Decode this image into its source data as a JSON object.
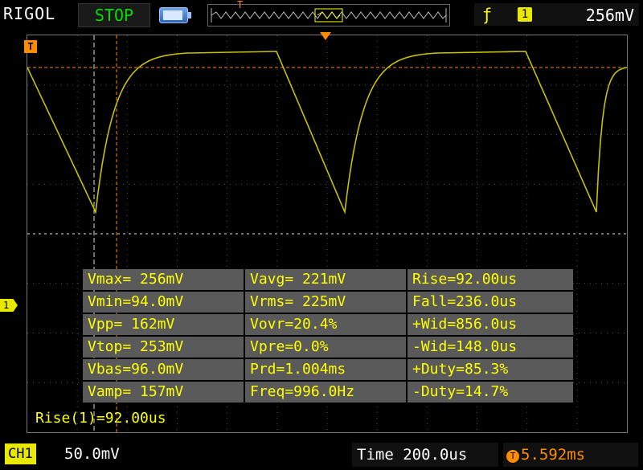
{
  "header": {
    "brand": "RIGOL",
    "run_state": "STOP",
    "trigger_source": "1",
    "trigger_edge_icon": "rising-edge-icon",
    "trigger_level": "256mV",
    "memory_marker": "T"
  },
  "screen": {
    "trigger_marker": "T",
    "channel_marker": "1"
  },
  "measurements": {
    "rows": [
      [
        "Vmax= 256mV",
        "Vavg= 221mV",
        "Rise=92.00us"
      ],
      [
        "Vmin=94.0mV",
        "Vrms= 225mV",
        "Fall=236.0us"
      ],
      [
        "Vpp= 162mV",
        "Vovr=20.4%",
        "+Wid=856.0us"
      ],
      [
        "Vtop= 253mV",
        "Vpre=0.0%",
        "-Wid=148.0us"
      ],
      [
        "Vbas=96.0mV",
        "Prd=1.004ms",
        "+Duty=85.3%"
      ],
      [
        "Vamp= 157mV",
        "Freq=996.0Hz",
        "-Duty=14.7%"
      ]
    ]
  },
  "cursor_readout": "Rise(1)=92.00us",
  "footer": {
    "channel_label": "CH1",
    "channel_scale": "50.0mV",
    "timebase": "Time 200.0us",
    "trigger_offset": "5.592ms"
  },
  "colors": {
    "trace": "#c8c000",
    "trigger": "#ff8c00",
    "measurement_text": "#ffff00",
    "run_state": "#00e000"
  }
}
